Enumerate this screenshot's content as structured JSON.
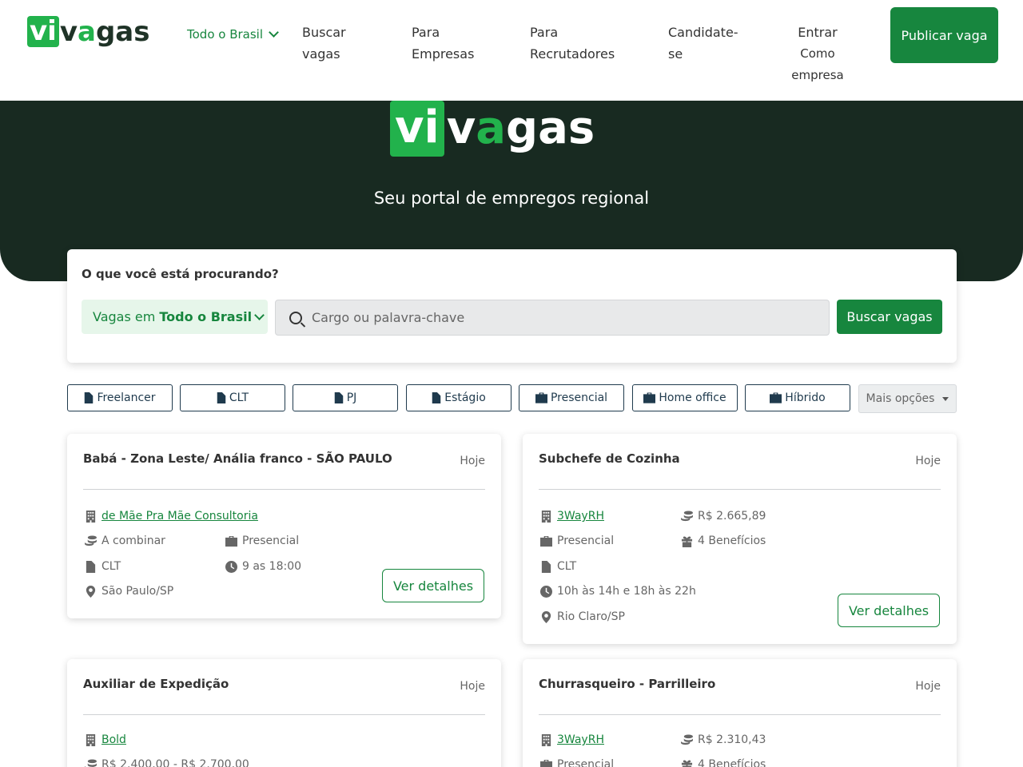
{
  "brand": {
    "logo_vi": "vi",
    "logo_v": "v",
    "logo_a": "a",
    "logo_gas": "gas",
    "accent": "#22b24c",
    "dark": "#182a21",
    "primary": "#17863e"
  },
  "nav": {
    "region": "Todo o Brasil",
    "links": [
      {
        "line1": "Buscar",
        "line2": "vagas"
      },
      {
        "line1": "Para",
        "line2": "Empresas"
      },
      {
        "line1": "Para",
        "line2": "Recrutadores"
      },
      {
        "line1": "Candidate-",
        "line2": "se"
      }
    ],
    "login": {
      "line1": "Entrar",
      "line2": "Como",
      "line3": "empresa"
    },
    "publish_label": "Publicar vaga"
  },
  "hero": {
    "tagline": "Seu portal de empregos regional"
  },
  "search": {
    "heading": "O que você está procurando?",
    "region_prefix": "Vagas em",
    "region_value": "Todo o Brasil",
    "placeholder": "Cargo ou palavra-chave",
    "button": "Buscar vagas"
  },
  "filters": [
    {
      "label": "Freelancer",
      "icon": "file-icon"
    },
    {
      "label": "CLT",
      "icon": "file-icon"
    },
    {
      "label": "PJ",
      "icon": "file-icon"
    },
    {
      "label": "Estágio",
      "icon": "file-icon"
    },
    {
      "label": "Presencial",
      "icon": "briefcase-icon"
    },
    {
      "label": "Home office",
      "icon": "briefcase-icon"
    },
    {
      "label": "Híbrido",
      "icon": "briefcase-icon"
    }
  ],
  "more_options": "Mais opções",
  "jobs": [
    {
      "title": "Babá - Zona Leste/ Anália franco - SÃO PAULO",
      "date": "Hoje",
      "company": "de Mãe Pra Mãe Consultoria",
      "salary": "A combinar",
      "work_mode": "Presencial",
      "contract": "CLT",
      "hours": "9 as 18:00",
      "location": "São Paulo/SP",
      "details": "Ver detalhes"
    },
    {
      "title": "Subchefe de Cozinha",
      "date": "Hoje",
      "company": "3WayRH",
      "salary": "R$ 2.665,89",
      "work_mode": "Presencial",
      "benefits": "4 Benefícios",
      "contract": "CLT",
      "hours": "10h às 14h e 18h às 22h",
      "location": "Rio Claro/SP",
      "details": "Ver detalhes"
    },
    {
      "title": "Auxiliar de Expedição",
      "date": "Hoje",
      "company": "Bold",
      "salary": "R$ 2.400,00 - R$ 2.700,00"
    },
    {
      "title": "Churrasqueiro - Parrilleiro",
      "date": "Hoje",
      "company": "3WayRH",
      "salary": "R$ 2.310,43",
      "work_mode": "Presencial",
      "benefits": "4 Benefícios"
    }
  ]
}
